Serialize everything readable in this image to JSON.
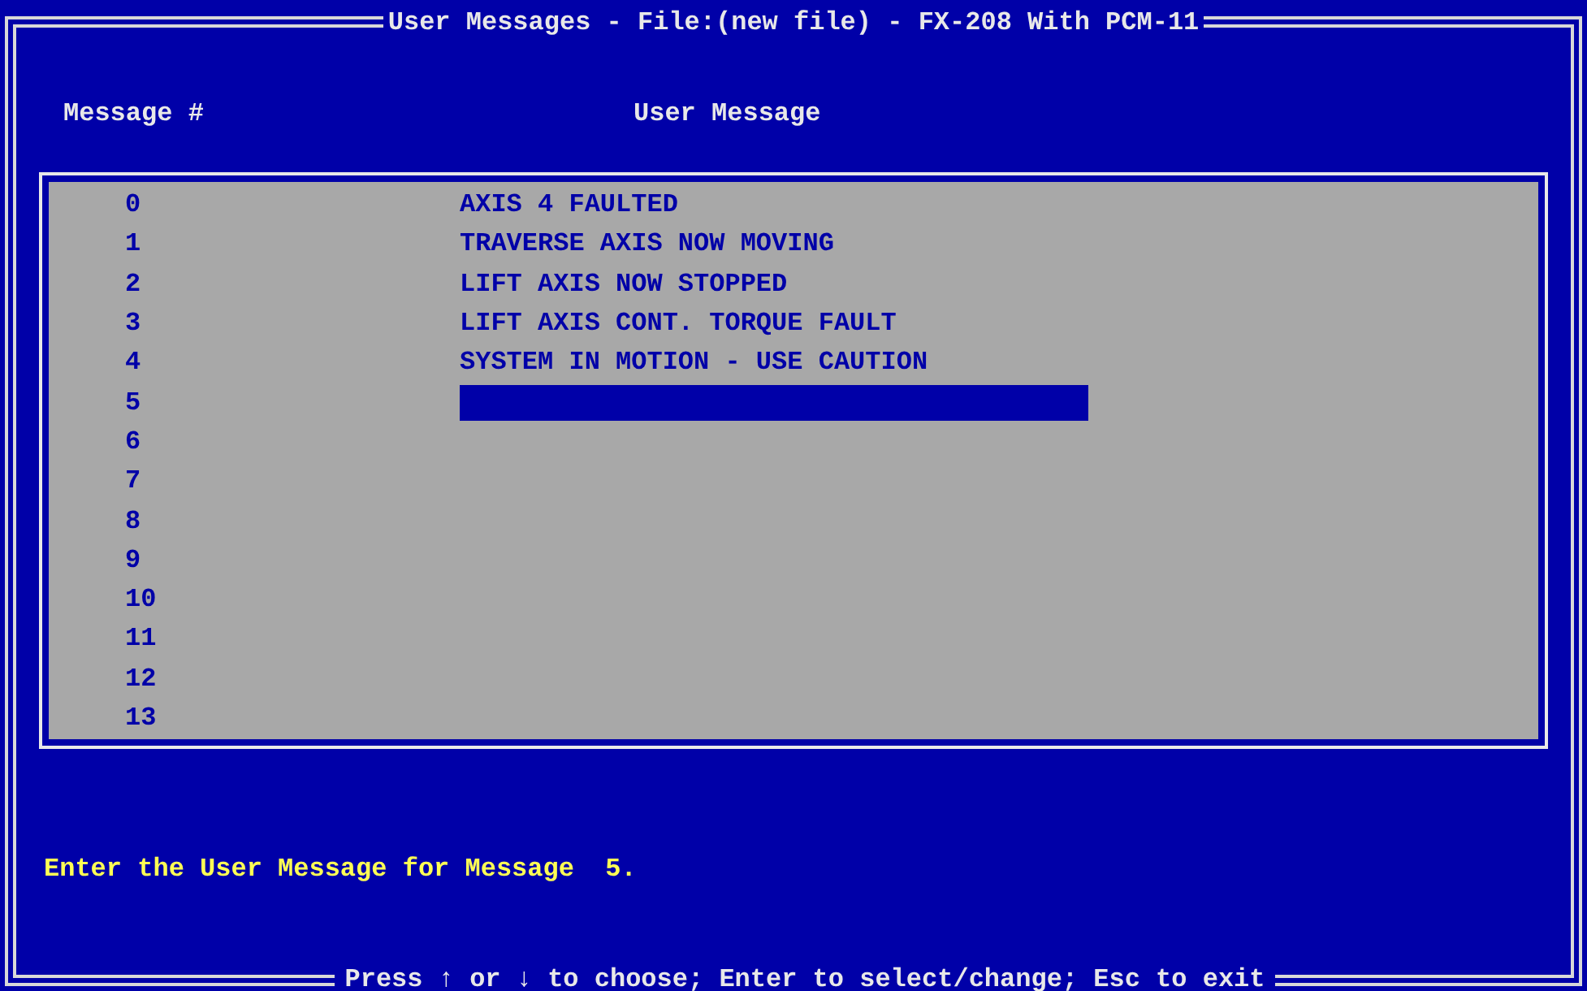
{
  "window": {
    "title": "User Messages - File:(new file) - FX-208 With PCM-11"
  },
  "table": {
    "columns": [
      "Message #",
      "User Message"
    ],
    "rows": [
      {
        "number": "0",
        "message": "AXIS 4 FAULTED",
        "selected": false
      },
      {
        "number": "1",
        "message": "TRAVERSE AXIS NOW MOVING",
        "selected": false
      },
      {
        "number": "2",
        "message": "LIFT AXIS NOW STOPPED",
        "selected": false
      },
      {
        "number": "3",
        "message": "LIFT AXIS CONT. TORQUE FAULT",
        "selected": false
      },
      {
        "number": "4",
        "message": "SYSTEM IN MOTION - USE CAUTION",
        "selected": false
      },
      {
        "number": "5",
        "selected": true
      },
      {
        "number": "6",
        "selected": false
      },
      {
        "number": "7",
        "selected": false
      },
      {
        "number": "8",
        "selected": false
      },
      {
        "number": "9",
        "selected": false
      },
      {
        "number": "10",
        "selected": false
      },
      {
        "number": "11",
        "selected": false
      },
      {
        "number": "12",
        "selected": false
      },
      {
        "number": "13",
        "selected": false
      }
    ]
  },
  "prompt": "Enter the User Message for Message  5.",
  "status_bar": "Press ↑ or ↓ to choose; Enter to select/change; Esc to exit"
}
